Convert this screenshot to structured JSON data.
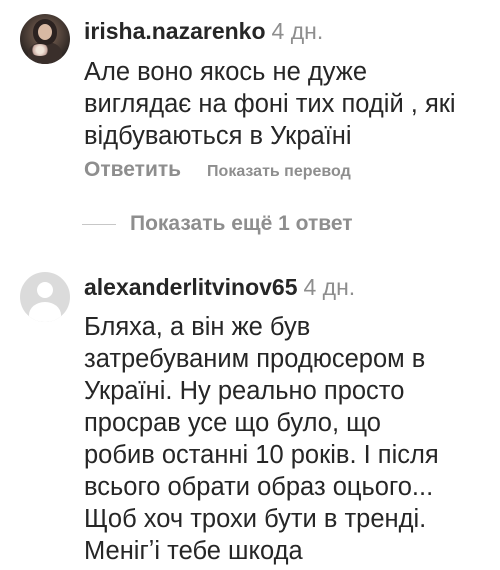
{
  "comments": [
    {
      "username": "irisha.nazarenko",
      "time": "4 дн.",
      "lines": [
        "Але воно якось не дуже",
        "виглядає на фоні тих подій , які",
        "відбуваються в Україні"
      ],
      "reply_label": "Ответить",
      "translate_label": "Показать перевод"
    },
    {
      "username": "alexanderlitvinov65",
      "time": "4 дн.",
      "lines": [
        "Бляха, а він же був",
        "затребуваним продюсером в",
        "Україні. Ну реально просто",
        "просрав усе що було, що",
        "робив останні 10 років. І після",
        "всього обрати образ оцього...",
        "Щоб хоч трохи бути в тренді.",
        "Менігʼі тебе шкода"
      ]
    }
  ],
  "more_replies_label": "Показать ещё 1 ответ"
}
